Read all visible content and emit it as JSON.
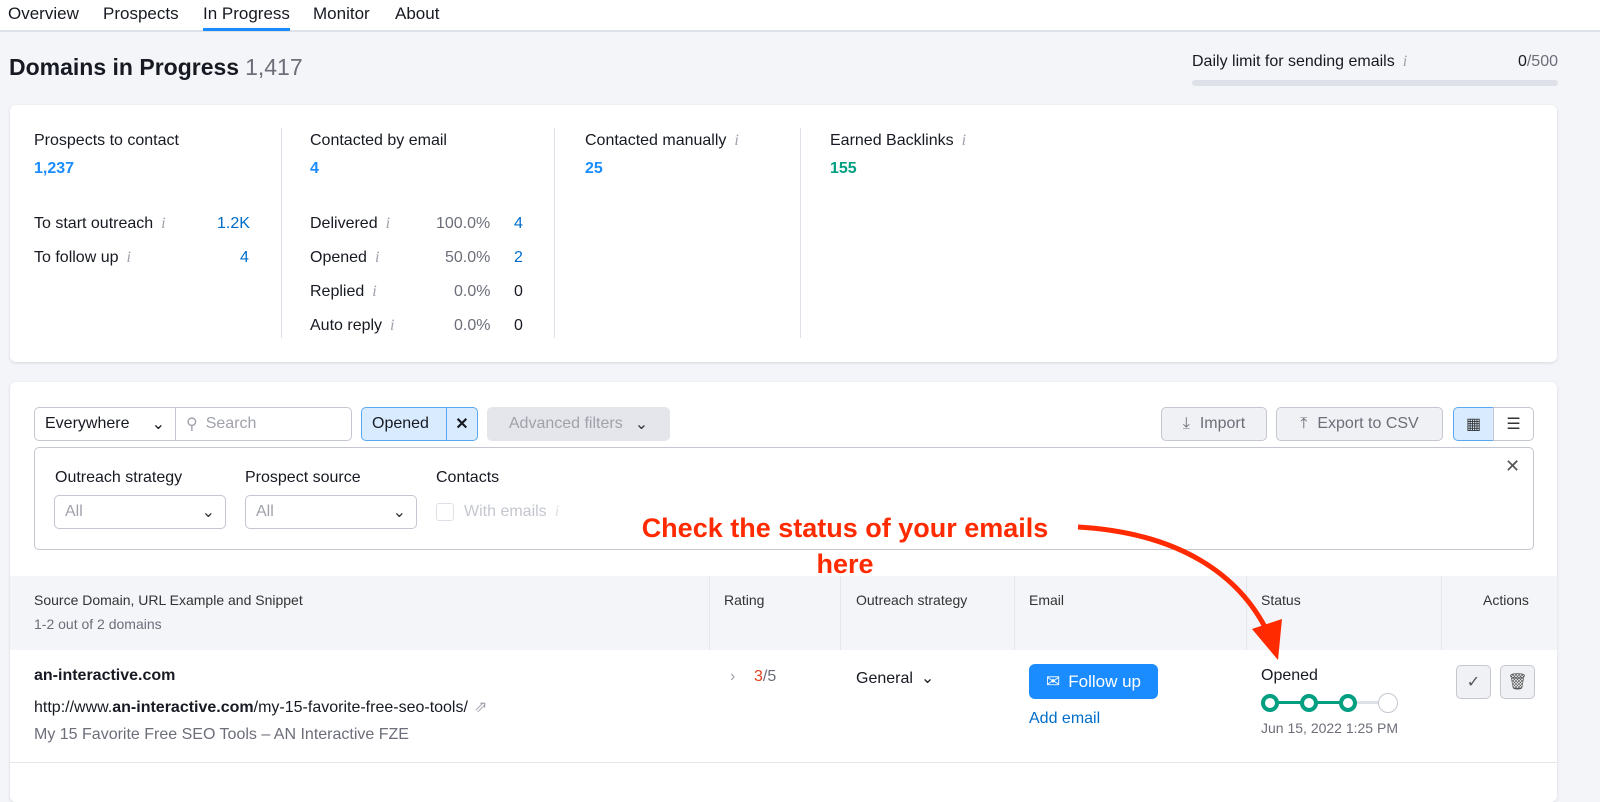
{
  "tabs": [
    "Overview",
    "Prospects",
    "In Progress",
    "Monitor",
    "About"
  ],
  "active_tab": "In Progress",
  "header": {
    "title": "Domains in Progress",
    "count": "1,417",
    "limit_label": "Daily limit for sending emails",
    "limit_used": "0",
    "limit_total": "/500"
  },
  "stats": {
    "prospects": {
      "label": "Prospects to contact",
      "value": "1,237",
      "rows": [
        {
          "label": "To start outreach",
          "value": "1.2K"
        },
        {
          "label": "To follow up",
          "value": "4"
        }
      ]
    },
    "email": {
      "label": "Contacted by email",
      "value": "4",
      "rows": [
        {
          "label": "Delivered",
          "pct": "100.0%",
          "value": "4"
        },
        {
          "label": "Opened",
          "pct": "50.0%",
          "value": "2"
        },
        {
          "label": "Replied",
          "pct": "0.0%",
          "value": "0"
        },
        {
          "label": "Auto reply",
          "pct": "0.0%",
          "value": "0"
        }
      ]
    },
    "manual": {
      "label": "Contacted manually",
      "value": "25"
    },
    "backlinks": {
      "label": "Earned Backlinks",
      "value": "155"
    }
  },
  "toolbar": {
    "scope": "Everywhere",
    "search_placeholder": "Search",
    "active_filter": "Opened",
    "advanced": "Advanced filters",
    "import": "Import",
    "export": "Export to CSV"
  },
  "filters": {
    "strategy_label": "Outreach strategy",
    "strategy_value": "All",
    "source_label": "Prospect source",
    "source_value": "All",
    "contacts_label": "Contacts",
    "with_emails": "With emails"
  },
  "annotation": {
    "line1": "Check the status of your emails",
    "line2": "here"
  },
  "table": {
    "headers": {
      "source": "Source Domain, URL Example and Snippet",
      "source_sub": "1-2 out of 2 domains",
      "rating": "Rating",
      "strategy": "Outreach strategy",
      "email": "Email",
      "status": "Status",
      "actions": "Actions"
    },
    "rows": [
      {
        "domain": "an-interactive.com",
        "url_prefix": "http://www.",
        "url_bold": "an-interactive.com",
        "url_suffix": "/my-15-favorite-free-seo-tools/",
        "snippet": "My 15 Favorite Free SEO Tools – AN Interactive FZE",
        "rating": "3",
        "rating_max": "/5",
        "strategy": "General",
        "email_button": "Follow up",
        "add_email": "Add email",
        "status": "Opened",
        "status_steps_done": 3,
        "status_steps_total": 4,
        "status_date": "Jun 15, 2022 1:25 PM"
      }
    ]
  },
  "colors": {
    "accent": "#1a8cff",
    "green": "#009f81",
    "annotation": "#ff2a00"
  }
}
